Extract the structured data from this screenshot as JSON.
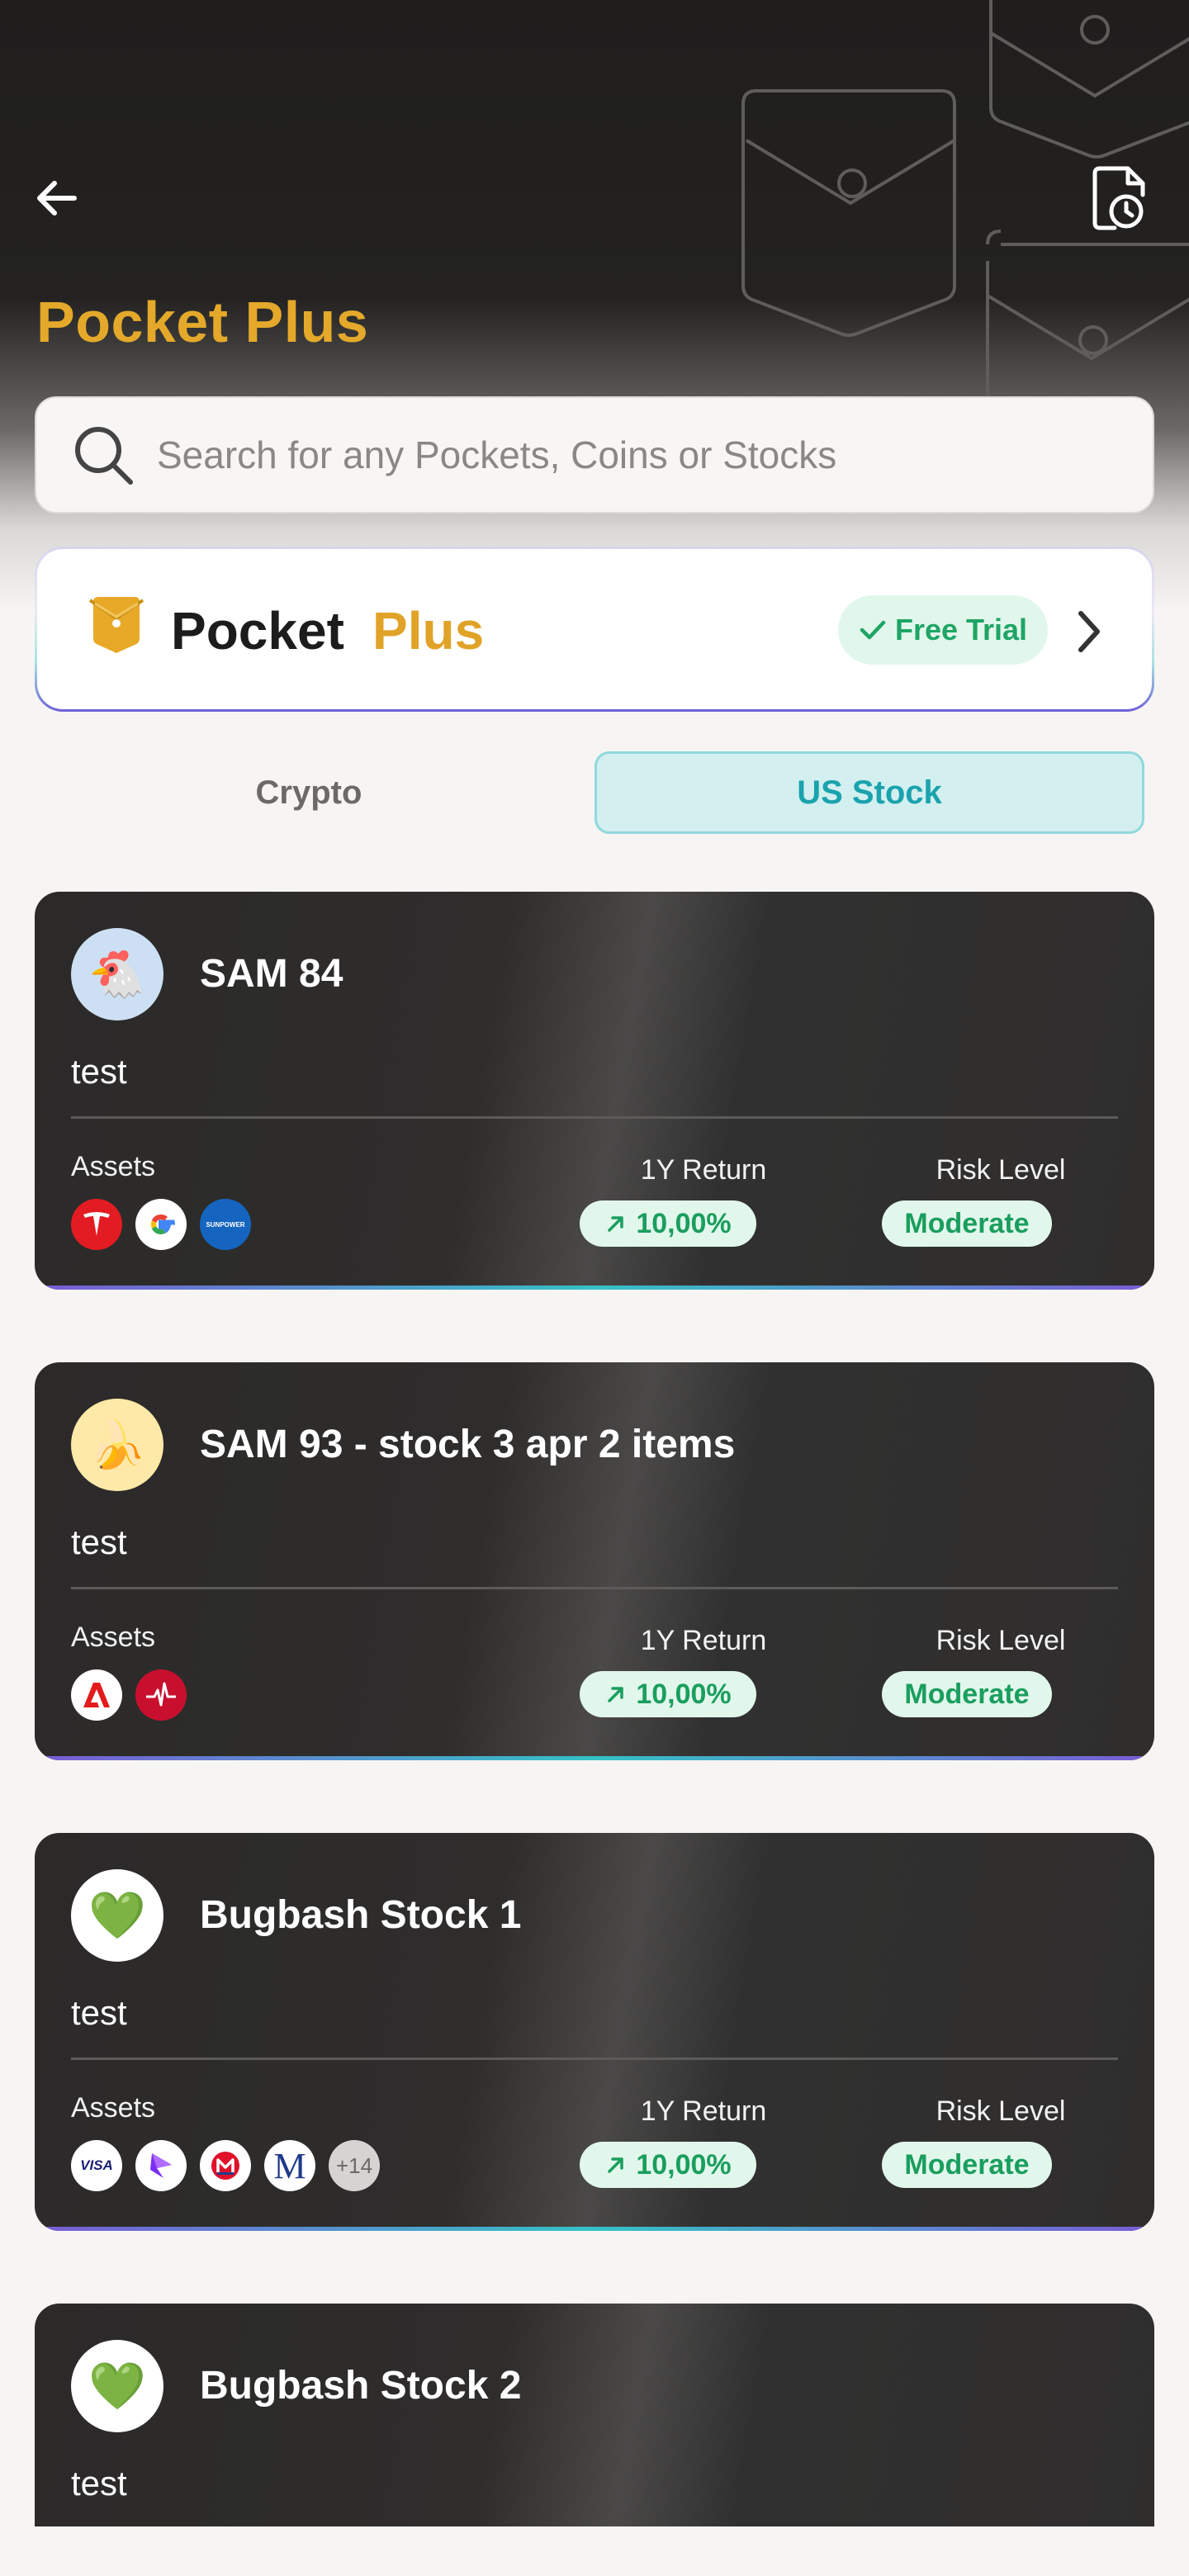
{
  "header": {
    "title": "Pocket Plus",
    "back_icon": "arrow-left-icon",
    "history_icon": "document-history-icon"
  },
  "search": {
    "placeholder": "Search for any Pockets, Coins or Stocks"
  },
  "promo": {
    "word1": "Pocket",
    "word2": "Plus",
    "badge": "Free Trial",
    "logo_icon": "pocket-logo-icon",
    "accent_color": "#E0A327"
  },
  "tabs": [
    {
      "label": "Crypto",
      "active": false
    },
    {
      "label": "US Stock",
      "active": true
    }
  ],
  "labels": {
    "assets": "Assets",
    "return": "1Y Return",
    "risk": "Risk Level"
  },
  "pockets": [
    {
      "title": "SAM 84",
      "description": "test",
      "avatar": "🐔",
      "assets": [
        "tesla-logo",
        "google-logo",
        "sunpower-logo"
      ],
      "return": "10,00%",
      "risk": "Moderate"
    },
    {
      "title": "SAM 93 - stock 3 apr 2 items",
      "description": "test",
      "avatar": "🍌",
      "assets": [
        "adobe-logo",
        "agilent-logo"
      ],
      "return": "10,00%",
      "risk": "Moderate"
    },
    {
      "title": "Bugbash Stock 1",
      "description": "test",
      "avatar": "💚",
      "assets": [
        "visa-logo",
        "pinduoduo-logo",
        "marathon-logo",
        "mcgraw-logo"
      ],
      "more": "+14",
      "return": "10,00%",
      "risk": "Moderate"
    },
    {
      "title": "Bugbash Stock 2",
      "description": "test",
      "avatar": "💚"
    }
  ],
  "asset_labels": {
    "sunpower": "SUNPOWER",
    "visa": "VISA",
    "mcgraw": "M"
  }
}
